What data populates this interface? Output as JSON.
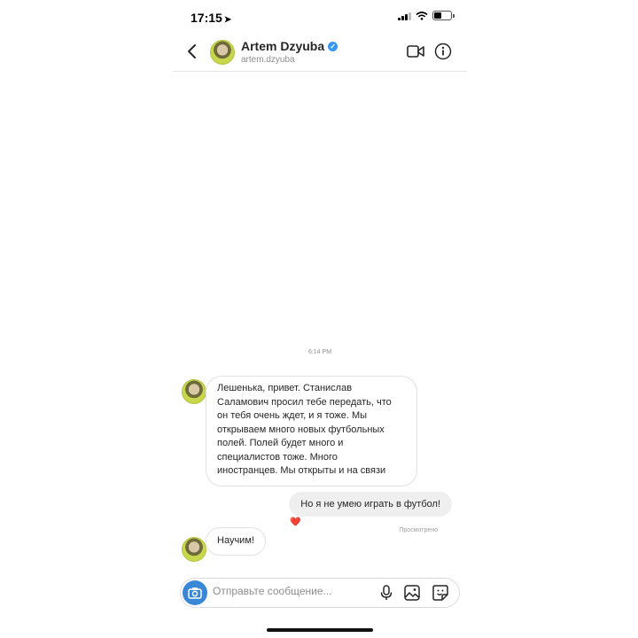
{
  "status_bar": {
    "time": "17:15"
  },
  "header": {
    "name": "Artem Dzyuba",
    "username": "artem.dzyuba",
    "verified_color": "#3897f0"
  },
  "chat": {
    "timestamp": "6:14 PM",
    "messages": [
      {
        "sender": "other",
        "text": "Лешенька, привет. Станислав\nСаламович просил тебе передать, что\nон тебя очень ждет, и я тоже. Мы\nоткрываем много новых футбольных\nполей.  Полей будет много и\nспециалистов тоже. Много\nиностранцев. Мы открыты и на связи"
      },
      {
        "sender": "me",
        "text": "Но я не умею играть в футбол!",
        "reaction": "❤️",
        "status": "Просмотрено"
      },
      {
        "sender": "other",
        "text": "Научим!"
      }
    ]
  },
  "composer": {
    "placeholder": "Отправьте сообщение..."
  },
  "icons": {
    "back": "chevron-left-icon",
    "video": "video-call-icon",
    "info": "info-icon",
    "camera": "camera-icon",
    "mic": "microphone-icon",
    "gallery": "gallery-icon",
    "sticker": "sticker-icon"
  },
  "colors": {
    "accent": "#3b87d7",
    "bubble_out": "#efefef"
  }
}
